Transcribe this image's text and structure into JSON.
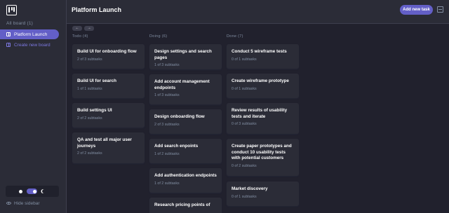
{
  "sidebar": {
    "all_boards": "All board (1)",
    "boards": [
      {
        "label": "Platform Launch"
      }
    ],
    "create_board": "Create new board",
    "hide_sidebar": "Hide sidebar"
  },
  "header": {
    "title": "Platform Launch",
    "add_task": "Add new task"
  },
  "nav": {
    "prev": "←",
    "next": "→"
  },
  "columns": [
    {
      "name": "Todo (4)",
      "tasks": [
        {
          "title": "Build UI for onboarding flow",
          "subtasks": "2 of 3 subtasks"
        },
        {
          "title": "Build UI for search",
          "subtasks": "1 of 1 subtasks"
        },
        {
          "title": "Build settings UI",
          "subtasks": "2 of 2 subtasks"
        },
        {
          "title": "QA and test all major user journeys",
          "subtasks": "2 of 2 subtasks"
        }
      ]
    },
    {
      "name": "Doing (6)",
      "tasks": [
        {
          "title": "Design settings and search pages",
          "subtasks": "1 of 3 subtasks"
        },
        {
          "title": "Add account management endpoints",
          "subtasks": "1 of 3 subtasks"
        },
        {
          "title": "Design onboarding flow",
          "subtasks": "2 of 3 subtasks"
        },
        {
          "title": "Add search enpoints",
          "subtasks": "1 of 2 subtasks"
        },
        {
          "title": "Add authentication endpoints",
          "subtasks": "1 of 2 subtasks"
        },
        {
          "title": "Research pricing points of",
          "subtasks": ""
        }
      ]
    },
    {
      "name": "Done (7)",
      "tasks": [
        {
          "title": "Conduct 5 wireframe tests",
          "subtasks": "0 of 1 subtasks"
        },
        {
          "title": "Create wireframe prototype",
          "subtasks": "0 of 1 subtasks"
        },
        {
          "title": "Review results of usability tests and iterate",
          "subtasks": "0 of 3 subtasks"
        },
        {
          "title": "Create paper prototypes and conduct 10 usability tests with potential customers",
          "subtasks": "0 of 2 subtasks"
        },
        {
          "title": "Market discovery",
          "subtasks": "0 of 1 subtasks"
        }
      ]
    }
  ],
  "colors": {
    "accent": "#635fc7",
    "bg": "#21212d",
    "panel": "#2b2c37",
    "muted": "#828fa3"
  },
  "icons": {
    "logo": "kanban-logo-icon",
    "board": "board-icon",
    "sun": "sun-icon",
    "moon": "moon-icon",
    "eye": "eye-off-icon",
    "layout": "layout-icon"
  }
}
